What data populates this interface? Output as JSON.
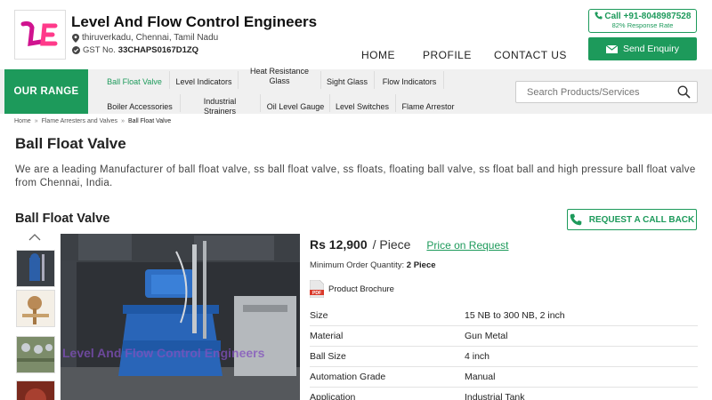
{
  "company": {
    "logo_text": "LE",
    "name": "Level And Flow Control Engineers",
    "location": "thiruverkadu, Chennai, Tamil Nadu",
    "gst_label": "GST No.",
    "gst_number": "33CHAPS0167D1ZQ"
  },
  "nav": [
    "HOME",
    "PROFILE",
    "CONTACT US"
  ],
  "contact": {
    "call_label": "Call +91-8048987528",
    "response_rate": "82% Response Rate",
    "enquiry_label": "Send Enquiry"
  },
  "range": {
    "label": "OUR RANGE",
    "items": [
      "Ball Float Valve",
      "Level Indicators",
      "Heat Resistance Glass",
      "Sight Glass",
      "Flow Indicators",
      "Boiler Accessories",
      "Industrial Strainers",
      "Oil Level Gauge",
      "Level Switches",
      "Flame Arrestor"
    ],
    "active_index": 0
  },
  "search": {
    "placeholder": "Search Products/Services"
  },
  "breadcrumb": [
    "Home",
    "Flame Arresters and Valves",
    "Ball Float Valve"
  ],
  "page": {
    "title": "Ball Float Valve",
    "intro": "We are a leading Manufacturer of ball float valve, ss ball float valve, ss floats, floating ball valve, ss float ball and high pressure ball float valve from Chennai, India."
  },
  "product": {
    "name": "Ball Float Valve",
    "callback_label": "REQUEST A CALL BACK",
    "price": "Rs 12,900",
    "price_unit": "/ Piece",
    "price_request": "Price on Request",
    "moq_label": "Minimum Order Quantity:",
    "moq_value": "2 Piece",
    "brochure": "Product Brochure",
    "watermark": "Level And Flow Control Engineers",
    "specs": [
      {
        "k": "Size",
        "v": "15 NB to 300 NB, 2 inch"
      },
      {
        "k": "Material",
        "v": "Gun Metal"
      },
      {
        "k": "Ball Size",
        "v": "4 inch"
      },
      {
        "k": "Automation Grade",
        "v": "Manual"
      },
      {
        "k": "Application",
        "v": "Industrial Tank"
      }
    ]
  },
  "colors": {
    "accent": "#1d9a5b",
    "logo_pink": "#d0138f"
  }
}
